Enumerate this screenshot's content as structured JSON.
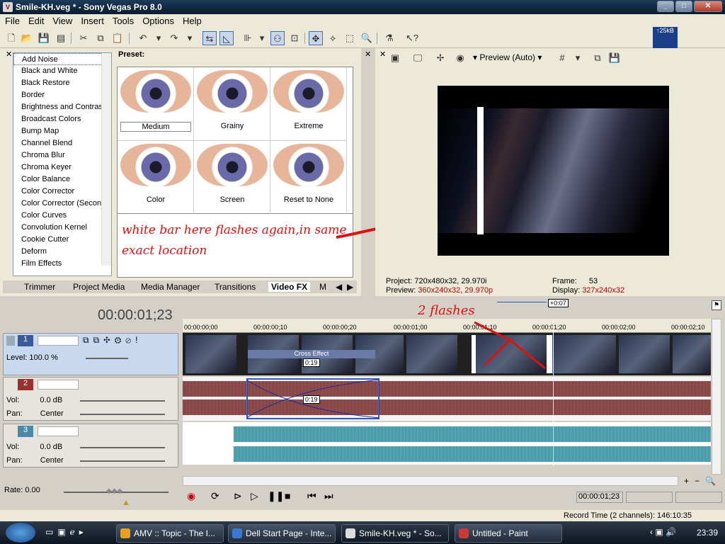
{
  "window": {
    "title": "Smile-KH.veg * - Sony Vegas Pro 8.0"
  },
  "menu": [
    "File",
    "Edit",
    "View",
    "Insert",
    "Tools",
    "Options",
    "Help"
  ],
  "meter": {
    "label": "↑25kB"
  },
  "fx": {
    "preset_label": "Preset:",
    "list": [
      "Add Noise",
      "Black and White",
      "Black Restore",
      "Border",
      "Brightness and Contrast",
      "Broadcast Colors",
      "Bump Map",
      "Channel Blend",
      "Chroma Blur",
      "Chroma Keyer",
      "Color Balance",
      "Color Corrector",
      "Color Corrector (Secondary)",
      "Color Curves",
      "Convolution Kernel",
      "Cookie Cutter",
      "Deform",
      "Film Effects"
    ],
    "presets": [
      "Medium",
      "Grainy",
      "Extreme",
      "Color",
      "Screen",
      "Reset to None"
    ]
  },
  "annotation": {
    "line1": "white bar here flashes again,in same",
    "line2": "exact location",
    "flashes": "2 flashes"
  },
  "tabs": [
    "Trimmer",
    "Project Media",
    "Media Manager",
    "Transitions",
    "Video FX",
    "M"
  ],
  "preview": {
    "mode": "Preview (Auto)",
    "project_label": "Project:",
    "project_value": "720x480x32, 29.970i",
    "preview_label": "Preview:",
    "preview_value": "360x240x32, 29.970p",
    "frame_label": "Frame:",
    "frame_value": "53",
    "display_label": "Display:",
    "display_value": "327x240x32"
  },
  "timeline": {
    "timecode": "00:00:01;23",
    "offset": "+0:07",
    "ruler": [
      "00:00:00;00",
      "00:00:00;10",
      "00:00:00;20",
      "00:00:01;00",
      "00:00:01;10",
      "00:00:01;20",
      "00:00:02;00",
      "00:00:02;10"
    ],
    "crossfade": "Cross Effect",
    "fade_len1": "0:19",
    "fade_len2": "0:19"
  },
  "tracks": [
    {
      "num": "1",
      "level_label": "Level:",
      "level_value": "100.0 %"
    },
    {
      "num": "2",
      "vol_label": "Vol:",
      "vol_value": "0.0 dB",
      "pan_label": "Pan:",
      "pan_value": "Center"
    },
    {
      "num": "3",
      "vol_label": "Vol:",
      "vol_value": "0.0 dB",
      "pan_label": "Pan:",
      "pan_value": "Center"
    }
  ],
  "rate": "Rate: 0.00",
  "transport_time": "00:00:01;23",
  "record_time": "Record Time (2 channels): 146:10:35",
  "taskbar": {
    "tasks": [
      "AMV :: Topic - The I...",
      "Dell Start Page - Inte...",
      "Smile-KH.veg * - So...",
      "Untitled - Paint"
    ],
    "clock": "23:39"
  }
}
